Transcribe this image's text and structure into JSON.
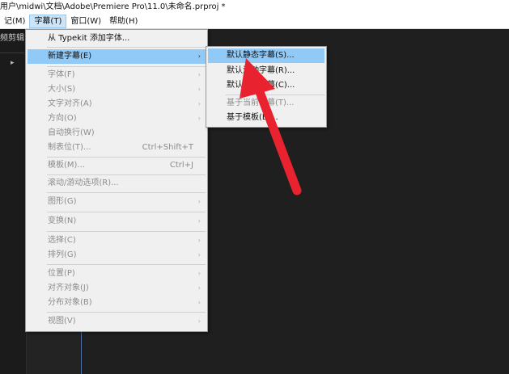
{
  "titlebar": {
    "text": "用户\\midwi\\文档\\Adobe\\Premiere Pro\\11.0\\未命名.prproj *"
  },
  "menubar": {
    "items": [
      {
        "label": "记(M)"
      },
      {
        "label": "字幕(T)"
      },
      {
        "label": "窗口(W)"
      },
      {
        "label": "帮助(H)"
      }
    ]
  },
  "panel": {
    "tab_label": "频剪辑",
    "arrow": "▸"
  },
  "menu": {
    "items": [
      {
        "label": "从 Typekit 添加字体..."
      },
      {
        "label": "新建字幕(E)",
        "arrow": "›"
      },
      {
        "label": "字体(F)",
        "arrow": "›"
      },
      {
        "label": "大小(S)",
        "arrow": "›"
      },
      {
        "label": "文字对齐(A)",
        "arrow": "›"
      },
      {
        "label": "方向(O)",
        "arrow": "›"
      },
      {
        "label": "自动换行(W)"
      },
      {
        "label": "制表位(T)...",
        "shortcut": "Ctrl+Shift+T"
      },
      {
        "label": "模板(M)...",
        "shortcut": "Ctrl+J"
      },
      {
        "label": "滚动/游动选项(R)..."
      },
      {
        "label": "图形(G)",
        "arrow": "›"
      },
      {
        "label": "变换(N)",
        "arrow": "›"
      },
      {
        "label": "选择(C)",
        "arrow": "›"
      },
      {
        "label": "排列(G)",
        "arrow": "›"
      },
      {
        "label": "位置(P)",
        "arrow": "›"
      },
      {
        "label": "对齐对象(J)",
        "arrow": "›"
      },
      {
        "label": "分布对象(B)",
        "arrow": "›"
      },
      {
        "label": "视图(V)",
        "arrow": "›"
      }
    ]
  },
  "submenu": {
    "items": [
      {
        "label": "默认静态字幕(S)..."
      },
      {
        "label": "默认滚动字幕(R)..."
      },
      {
        "label": "默认游动字幕(C)..."
      },
      {
        "label": "基于当前字幕(T)..."
      },
      {
        "label": "基于模板(E)..."
      }
    ]
  },
  "colors": {
    "highlight": "#91c9f7",
    "annotation": "#e8232f",
    "timeline_line": "#4a6fa5"
  }
}
